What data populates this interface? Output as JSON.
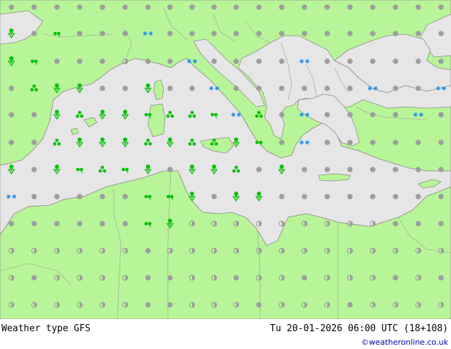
{
  "footer": {
    "title": "Weather type   GFS",
    "timestamp": "Tu 20-01-2026 06:00 UTC (18+108)",
    "credit": "©weatheronline.co.uk"
  },
  "colors": {
    "sea": "#e6e6e6",
    "land": "#b8f598",
    "border": "#9a9a9a",
    "coast": "#8c8c8c",
    "dry_dot": "#9e9e9e",
    "rain": "#0ac00a",
    "snow": "#1a8ff0"
  },
  "legend_types": {
    "dry": "dry-dot-icon",
    "cloudy": "half-dot-icon",
    "drizzle": "drizzle-icon",
    "rain": "rain-icon",
    "showers": "shower-icon",
    "snow": "snow-icon"
  }
}
